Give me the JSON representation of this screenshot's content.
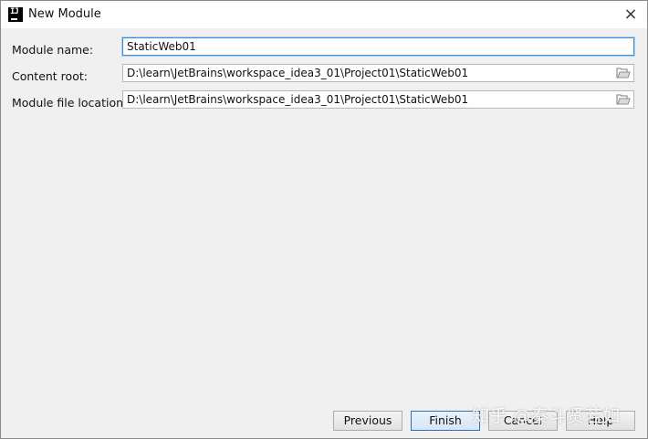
{
  "window": {
    "title": "New Module",
    "icon": "intellij-idea-icon",
    "close": "×"
  },
  "form": {
    "module_name_label": "Module name:",
    "module_name_value": "StaticWeb01",
    "content_root_label": "Content root:",
    "content_root_value": "D:\\learn\\JetBrains\\workspace_idea3_01\\Project01\\StaticWeb01",
    "module_file_location_label": "Module file location:",
    "module_file_location_value": "D:\\learn\\JetBrains\\workspace_idea3_01\\Project01\\StaticWeb01",
    "browse_icon": "folder-open-icon"
  },
  "buttons": {
    "previous": "Previous",
    "finish": "Finish",
    "cancel": "Cancel",
    "help": "Help"
  },
  "watermark": {
    "text": "知乎 @秦斗贤若如"
  },
  "colors": {
    "focus_border": "#3c8fd6",
    "dialog_bg": "#f0f0f0"
  }
}
